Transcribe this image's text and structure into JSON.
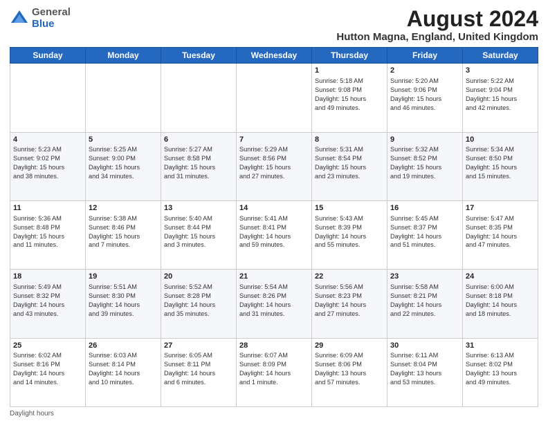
{
  "header": {
    "logo_general": "General",
    "logo_blue": "Blue",
    "month_title": "August 2024",
    "location": "Hutton Magna, England, United Kingdom"
  },
  "weekdays": [
    "Sunday",
    "Monday",
    "Tuesday",
    "Wednesday",
    "Thursday",
    "Friday",
    "Saturday"
  ],
  "weeks": [
    [
      {
        "day": "",
        "info": ""
      },
      {
        "day": "",
        "info": ""
      },
      {
        "day": "",
        "info": ""
      },
      {
        "day": "",
        "info": ""
      },
      {
        "day": "1",
        "info": "Sunrise: 5:18 AM\nSunset: 9:08 PM\nDaylight: 15 hours\nand 49 minutes."
      },
      {
        "day": "2",
        "info": "Sunrise: 5:20 AM\nSunset: 9:06 PM\nDaylight: 15 hours\nand 46 minutes."
      },
      {
        "day": "3",
        "info": "Sunrise: 5:22 AM\nSunset: 9:04 PM\nDaylight: 15 hours\nand 42 minutes."
      }
    ],
    [
      {
        "day": "4",
        "info": "Sunrise: 5:23 AM\nSunset: 9:02 PM\nDaylight: 15 hours\nand 38 minutes."
      },
      {
        "day": "5",
        "info": "Sunrise: 5:25 AM\nSunset: 9:00 PM\nDaylight: 15 hours\nand 34 minutes."
      },
      {
        "day": "6",
        "info": "Sunrise: 5:27 AM\nSunset: 8:58 PM\nDaylight: 15 hours\nand 31 minutes."
      },
      {
        "day": "7",
        "info": "Sunrise: 5:29 AM\nSunset: 8:56 PM\nDaylight: 15 hours\nand 27 minutes."
      },
      {
        "day": "8",
        "info": "Sunrise: 5:31 AM\nSunset: 8:54 PM\nDaylight: 15 hours\nand 23 minutes."
      },
      {
        "day": "9",
        "info": "Sunrise: 5:32 AM\nSunset: 8:52 PM\nDaylight: 15 hours\nand 19 minutes."
      },
      {
        "day": "10",
        "info": "Sunrise: 5:34 AM\nSunset: 8:50 PM\nDaylight: 15 hours\nand 15 minutes."
      }
    ],
    [
      {
        "day": "11",
        "info": "Sunrise: 5:36 AM\nSunset: 8:48 PM\nDaylight: 15 hours\nand 11 minutes."
      },
      {
        "day": "12",
        "info": "Sunrise: 5:38 AM\nSunset: 8:46 PM\nDaylight: 15 hours\nand 7 minutes."
      },
      {
        "day": "13",
        "info": "Sunrise: 5:40 AM\nSunset: 8:44 PM\nDaylight: 15 hours\nand 3 minutes."
      },
      {
        "day": "14",
        "info": "Sunrise: 5:41 AM\nSunset: 8:41 PM\nDaylight: 14 hours\nand 59 minutes."
      },
      {
        "day": "15",
        "info": "Sunrise: 5:43 AM\nSunset: 8:39 PM\nDaylight: 14 hours\nand 55 minutes."
      },
      {
        "day": "16",
        "info": "Sunrise: 5:45 AM\nSunset: 8:37 PM\nDaylight: 14 hours\nand 51 minutes."
      },
      {
        "day": "17",
        "info": "Sunrise: 5:47 AM\nSunset: 8:35 PM\nDaylight: 14 hours\nand 47 minutes."
      }
    ],
    [
      {
        "day": "18",
        "info": "Sunrise: 5:49 AM\nSunset: 8:32 PM\nDaylight: 14 hours\nand 43 minutes."
      },
      {
        "day": "19",
        "info": "Sunrise: 5:51 AM\nSunset: 8:30 PM\nDaylight: 14 hours\nand 39 minutes."
      },
      {
        "day": "20",
        "info": "Sunrise: 5:52 AM\nSunset: 8:28 PM\nDaylight: 14 hours\nand 35 minutes."
      },
      {
        "day": "21",
        "info": "Sunrise: 5:54 AM\nSunset: 8:26 PM\nDaylight: 14 hours\nand 31 minutes."
      },
      {
        "day": "22",
        "info": "Sunrise: 5:56 AM\nSunset: 8:23 PM\nDaylight: 14 hours\nand 27 minutes."
      },
      {
        "day": "23",
        "info": "Sunrise: 5:58 AM\nSunset: 8:21 PM\nDaylight: 14 hours\nand 22 minutes."
      },
      {
        "day": "24",
        "info": "Sunrise: 6:00 AM\nSunset: 8:18 PM\nDaylight: 14 hours\nand 18 minutes."
      }
    ],
    [
      {
        "day": "25",
        "info": "Sunrise: 6:02 AM\nSunset: 8:16 PM\nDaylight: 14 hours\nand 14 minutes."
      },
      {
        "day": "26",
        "info": "Sunrise: 6:03 AM\nSunset: 8:14 PM\nDaylight: 14 hours\nand 10 minutes."
      },
      {
        "day": "27",
        "info": "Sunrise: 6:05 AM\nSunset: 8:11 PM\nDaylight: 14 hours\nand 6 minutes."
      },
      {
        "day": "28",
        "info": "Sunrise: 6:07 AM\nSunset: 8:09 PM\nDaylight: 14 hours\nand 1 minute."
      },
      {
        "day": "29",
        "info": "Sunrise: 6:09 AM\nSunset: 8:06 PM\nDaylight: 13 hours\nand 57 minutes."
      },
      {
        "day": "30",
        "info": "Sunrise: 6:11 AM\nSunset: 8:04 PM\nDaylight: 13 hours\nand 53 minutes."
      },
      {
        "day": "31",
        "info": "Sunrise: 6:13 AM\nSunset: 8:02 PM\nDaylight: 13 hours\nand 49 minutes."
      }
    ]
  ],
  "footer": {
    "daylight_hours": "Daylight hours"
  }
}
